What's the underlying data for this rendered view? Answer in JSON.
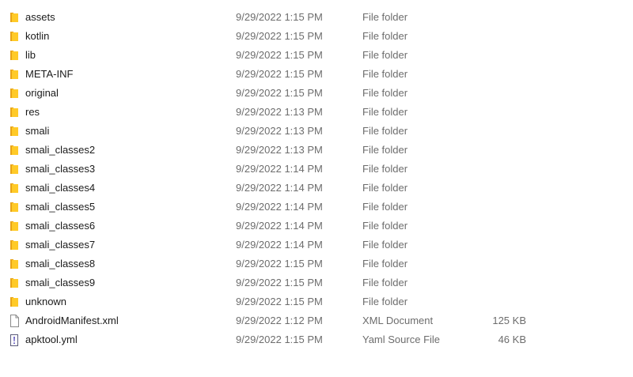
{
  "rows": [
    {
      "name": "assets",
      "date": "9/29/2022 1:15 PM",
      "type": "File folder",
      "size": "",
      "icon": "folder-icon"
    },
    {
      "name": "kotlin",
      "date": "9/29/2022 1:15 PM",
      "type": "File folder",
      "size": "",
      "icon": "folder-icon"
    },
    {
      "name": "lib",
      "date": "9/29/2022 1:15 PM",
      "type": "File folder",
      "size": "",
      "icon": "folder-icon"
    },
    {
      "name": "META-INF",
      "date": "9/29/2022 1:15 PM",
      "type": "File folder",
      "size": "",
      "icon": "folder-icon"
    },
    {
      "name": "original",
      "date": "9/29/2022 1:15 PM",
      "type": "File folder",
      "size": "",
      "icon": "folder-icon"
    },
    {
      "name": "res",
      "date": "9/29/2022 1:13 PM",
      "type": "File folder",
      "size": "",
      "icon": "folder-icon"
    },
    {
      "name": "smali",
      "date": "9/29/2022 1:13 PM",
      "type": "File folder",
      "size": "",
      "icon": "folder-icon"
    },
    {
      "name": "smali_classes2",
      "date": "9/29/2022 1:13 PM",
      "type": "File folder",
      "size": "",
      "icon": "folder-icon"
    },
    {
      "name": "smali_classes3",
      "date": "9/29/2022 1:14 PM",
      "type": "File folder",
      "size": "",
      "icon": "folder-icon"
    },
    {
      "name": "smali_classes4",
      "date": "9/29/2022 1:14 PM",
      "type": "File folder",
      "size": "",
      "icon": "folder-icon"
    },
    {
      "name": "smali_classes5",
      "date": "9/29/2022 1:14 PM",
      "type": "File folder",
      "size": "",
      "icon": "folder-icon"
    },
    {
      "name": "smali_classes6",
      "date": "9/29/2022 1:14 PM",
      "type": "File folder",
      "size": "",
      "icon": "folder-icon"
    },
    {
      "name": "smali_classes7",
      "date": "9/29/2022 1:14 PM",
      "type": "File folder",
      "size": "",
      "icon": "folder-icon"
    },
    {
      "name": "smali_classes8",
      "date": "9/29/2022 1:15 PM",
      "type": "File folder",
      "size": "",
      "icon": "folder-icon"
    },
    {
      "name": "smali_classes9",
      "date": "9/29/2022 1:15 PM",
      "type": "File folder",
      "size": "",
      "icon": "folder-icon"
    },
    {
      "name": "unknown",
      "date": "9/29/2022 1:15 PM",
      "type": "File folder",
      "size": "",
      "icon": "folder-icon"
    },
    {
      "name": "AndroidManifest.xml",
      "date": "9/29/2022 1:12 PM",
      "type": "XML Document",
      "size": "125 KB",
      "icon": "xml-file-icon"
    },
    {
      "name": "apktool.yml",
      "date": "9/29/2022 1:15 PM",
      "type": "Yaml Source File",
      "size": "46 KB",
      "icon": "yaml-file-icon"
    }
  ],
  "colors": {
    "folder_body": "#FFCA28",
    "folder_back": "#E8A317",
    "name_text": "#1b1b1b",
    "meta_text": "#6d6d6d"
  }
}
